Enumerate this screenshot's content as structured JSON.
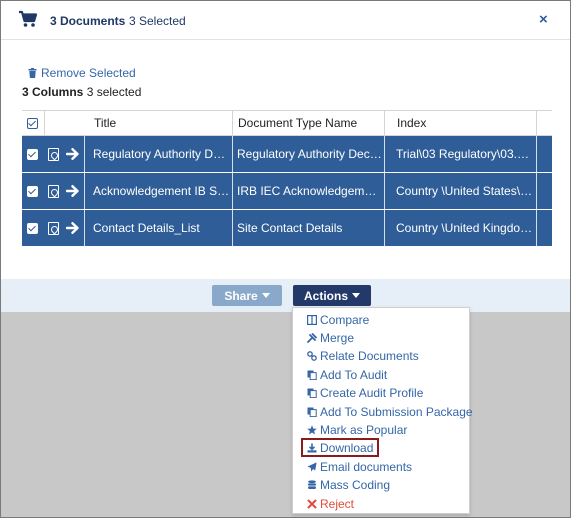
{
  "header": {
    "documents_label": "3 Documents",
    "selected_label": "3 Selected",
    "close_glyph": "×"
  },
  "toolbar": {
    "remove_selected": "Remove Selected",
    "columns_bold": "3 Columns",
    "columns_selected": "3 selected"
  },
  "table": {
    "columns": [
      "Title",
      "Document Type Name",
      "Index"
    ],
    "rows": [
      {
        "title": "Regulatory Authority Deci...",
        "type": "Regulatory Authority Decisi...",
        "index": "Trial\\03 Regulatory\\03.01 ..."
      },
      {
        "title": "Acknowledgement IB Sign...",
        "type": "IRB IEC Acknowledgement ...",
        "index": "Country \\United States\\04..."
      },
      {
        "title": "Contact Details_List",
        "type": "Site Contact Details",
        "index": "Country \\United Kingdom..."
      }
    ]
  },
  "buttons": {
    "share": "Share",
    "actions": "Actions"
  },
  "actions_menu": [
    {
      "label": "Compare",
      "icon": "compare-icon"
    },
    {
      "label": "Merge",
      "icon": "merge-icon"
    },
    {
      "label": "Relate Documents",
      "icon": "link-icon"
    },
    {
      "label": "Add To Audit",
      "icon": "copy-icon"
    },
    {
      "label": "Create Audit Profile",
      "icon": "copy-icon"
    },
    {
      "label": "Add To Submission Package",
      "icon": "copy-icon"
    },
    {
      "label": "Mark as Popular",
      "icon": "star-icon"
    },
    {
      "label": "Download",
      "icon": "download-icon"
    },
    {
      "label": "Email documents",
      "icon": "send-icon"
    },
    {
      "label": "Mass Coding",
      "icon": "database-icon"
    },
    {
      "label": "Reject",
      "icon": "x-icon"
    }
  ],
  "colors": {
    "accent": "#2f5d97",
    "dark_button": "#22396a",
    "light_button": "#8aa9ca",
    "link": "#3566a8",
    "reject": "#e24a3b",
    "highlight_border": "#8b1a1a"
  }
}
